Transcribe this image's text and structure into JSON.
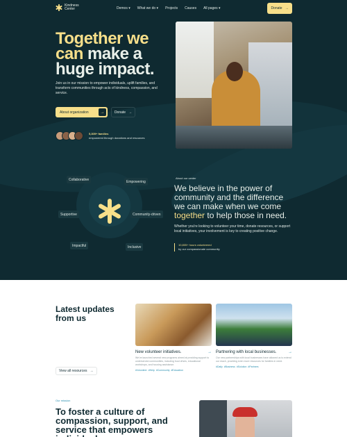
{
  "nav": {
    "logo_text": "Kindness Center",
    "menu": [
      "Demos ▾",
      "What we do ▾",
      "Projects",
      "Causes",
      "All pages ▾"
    ],
    "donate": "Donate",
    "arrow": "→"
  },
  "hero": {
    "title_line1": "Together we",
    "title_line2_hl": "can",
    "title_line2_rest": " make a",
    "title_line3": "huge impact.",
    "description": "Join us in our mission to empower individuals, uplift families, and transform communities through acts of kindness, compassion, and service.",
    "btn_about": "About organization",
    "btn_donate": "Donate",
    "arrow": "→",
    "families_count": "5,305+ families",
    "families_text": "empowered through donations and resources",
    "avatar_colors": [
      "#c99c7a",
      "#8a6248",
      "#d9b08c",
      "#6e4b36"
    ]
  },
  "values": {
    "collaborative": "Collaborative",
    "empowering": "Empowering",
    "supportive": "Supportive",
    "community_driven": "Community-driven",
    "impactful": "Impactful",
    "inclusive": "Inclusive"
  },
  "about": {
    "label": "About our center",
    "title_pre": "We believe in the power of community and the difference we can make when we come",
    "title_hl": "together",
    "title_post": " to help those in need.",
    "description": "Whether you're looking to volunteer your time, donate resources, or support local initiatives, your involvement is key to creating positive change.",
    "stat_value": "10,805+ hours volunteered",
    "stat_text": "by our compassionate community"
  },
  "updates": {
    "title": "Latest updates from us",
    "view_all": "View all resources",
    "arrow": "→",
    "cards": [
      {
        "title": "New volunteer initiatives.",
        "description": "We've launched several new programs aimed at providing support to underserved communities, including food drives, educational workshops, and housing assistance.",
        "tags": "#Volunteer #Help #Community #Education",
        "arrow": "→"
      },
      {
        "title": "Partnering with local businesses.",
        "description": "Our new partnerships with local businesses have allowed us to extend our reach, providing even more resources for families in need.",
        "tags": "#Daily #Business #Solution #Partners",
        "arrow": "→"
      }
    ]
  },
  "mission": {
    "label": "Our mission",
    "title": "To foster a culture of compassion, support, and service that empowers individuals."
  },
  "colors": {
    "dark_bg": "#0f2a31",
    "accent": "#f7df8a",
    "link": "#2a8fb0"
  }
}
